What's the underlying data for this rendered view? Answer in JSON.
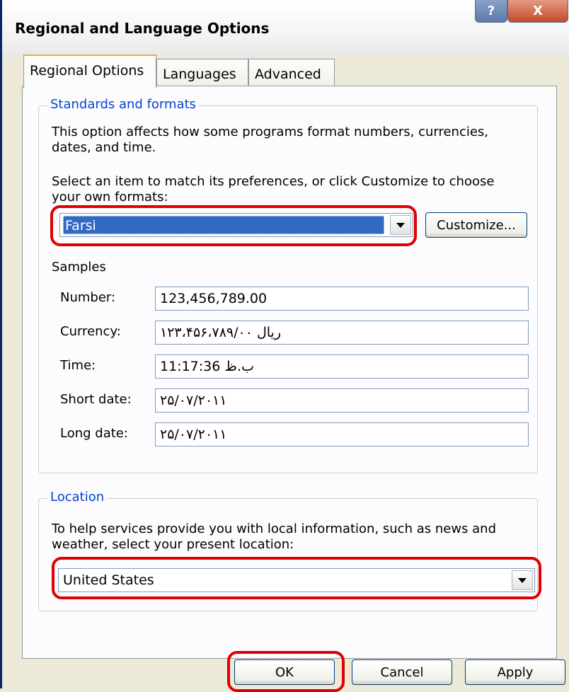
{
  "window": {
    "title": "Regional and Language Options",
    "help_button": "?",
    "close_button": "X"
  },
  "tabs": [
    {
      "label": "Regional Options",
      "active": true
    },
    {
      "label": "Languages",
      "active": false
    },
    {
      "label": "Advanced",
      "active": false
    }
  ],
  "standards": {
    "legend": "Standards and formats",
    "description": "This option affects how some programs format numbers, currencies, dates, and time.",
    "select_prompt_line1": "Select an item to match its preferences, or click Customize to choose",
    "select_prompt_line2": "your own formats:",
    "selected_format": "Farsi",
    "customize_button": "Customize...",
    "samples_label": "Samples",
    "samples": [
      {
        "label": "Number:",
        "value": "123,456,789.00"
      },
      {
        "label": "Currency:",
        "value": "ریال ۱۲۳،۴۵۶،۷۸۹/۰۰"
      },
      {
        "label": "Time:",
        "value": "11:17:36 ب.ظ"
      },
      {
        "label": "Short date:",
        "value": "۲۵/۰۷/۲۰۱۱"
      },
      {
        "label": "Long date:",
        "value": "۲۵/۰۷/۲۰۱۱"
      }
    ]
  },
  "location": {
    "legend": "Location",
    "description_line1": "To help services provide you with local information, such as news and",
    "description_line2": "weather, select your present location:",
    "selected_location": "United States"
  },
  "footer": {
    "ok_button": "OK",
    "cancel_button": "Cancel",
    "apply_button": "Apply"
  },
  "colors": {
    "highlight_outline": "#e00000",
    "selection_blue": "#316ac5",
    "legend_blue": "#0046d5"
  }
}
